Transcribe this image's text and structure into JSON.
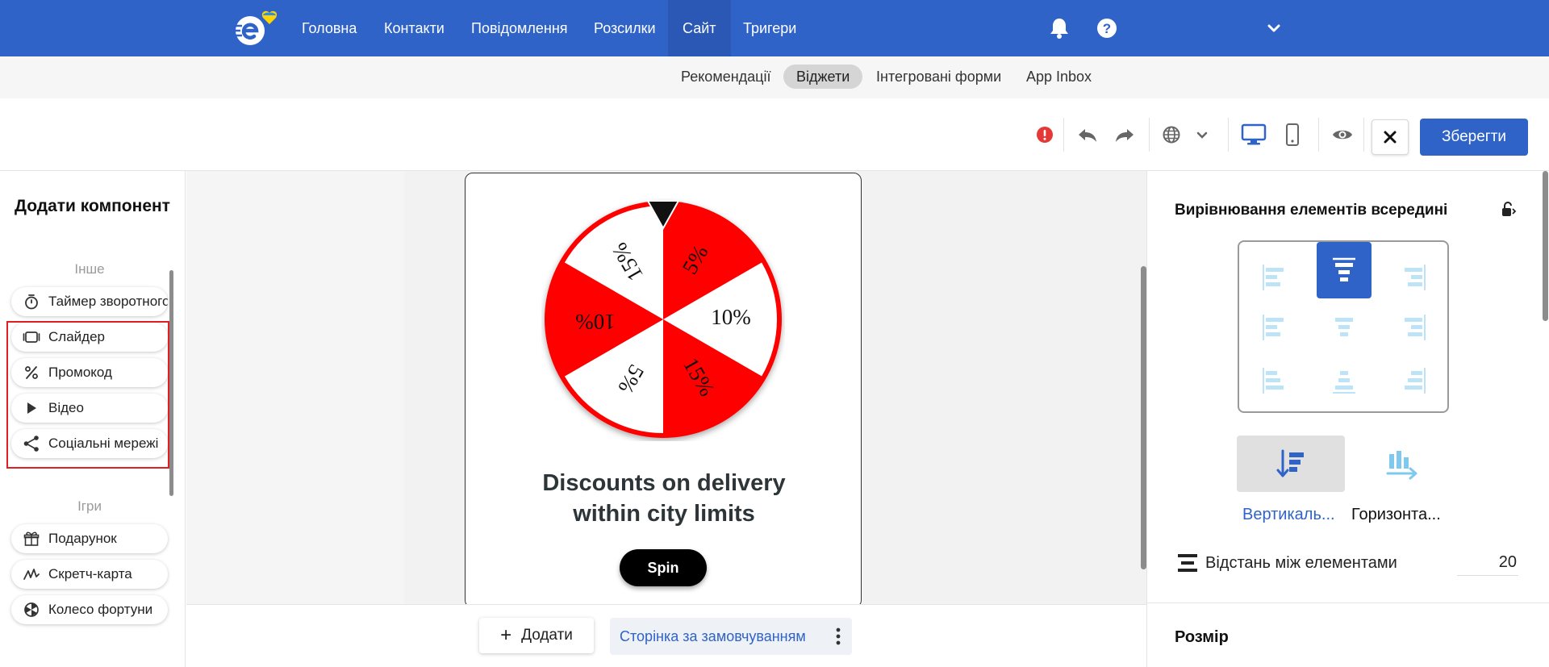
{
  "topnav": {
    "items": [
      {
        "label": "Головна"
      },
      {
        "label": "Контакти"
      },
      {
        "label": "Повідомлення"
      },
      {
        "label": "Розсилки"
      },
      {
        "label": "Сайт"
      },
      {
        "label": "Тригери"
      }
    ],
    "active": "Сайт"
  },
  "subnav": {
    "items": [
      {
        "label": "Рекомендації"
      },
      {
        "label": "Віджети"
      },
      {
        "label": "Інтегровані форми"
      },
      {
        "label": "App Inbox"
      }
    ],
    "active": "Віджети"
  },
  "toolbar": {
    "save_label": "Зберегти"
  },
  "left_panel": {
    "title": "Додати компонент",
    "groups": [
      {
        "label": "Інше",
        "items": [
          {
            "label": "Таймер зворотного",
            "icon": "timer-icon"
          },
          {
            "label": "Слайдер",
            "icon": "slider-icon"
          },
          {
            "label": "Промокод",
            "icon": "percent-icon"
          },
          {
            "label": "Відео",
            "icon": "play-icon"
          },
          {
            "label": "Соціальні мережі",
            "icon": "share-icon"
          }
        ]
      },
      {
        "label": "Ігри",
        "items": [
          {
            "label": "Подарунок",
            "icon": "gift-icon"
          },
          {
            "label": "Скретч-карта",
            "icon": "scratch-icon"
          },
          {
            "label": "Колесо фортуни",
            "icon": "wheel-icon"
          }
        ]
      }
    ]
  },
  "widget": {
    "wheel_segments": [
      "5%",
      "10%",
      "15%",
      "5%",
      "10%",
      "15%"
    ],
    "headline_line1": "Discounts on delivery",
    "headline_line2": "within city limits",
    "button_label": "Spin",
    "colors": {
      "red": "#ff0000",
      "white": "#ffffff"
    }
  },
  "bottom_bar": {
    "add_label": "Додати",
    "page_label": "Сторінка за замовчуванням"
  },
  "right_panel": {
    "alignment_title": "Вирівнювання елементів всередині",
    "direction_vertical": "Вертикаль...",
    "direction_horizontal": "Горизонта...",
    "spacing_label": "Відстань між елементами",
    "spacing_value": "20",
    "size_title": "Розмір"
  },
  "colors": {
    "brand_blue": "#2f63c8",
    "alert_red": "#e53935",
    "highlight_red": "#e02020"
  }
}
